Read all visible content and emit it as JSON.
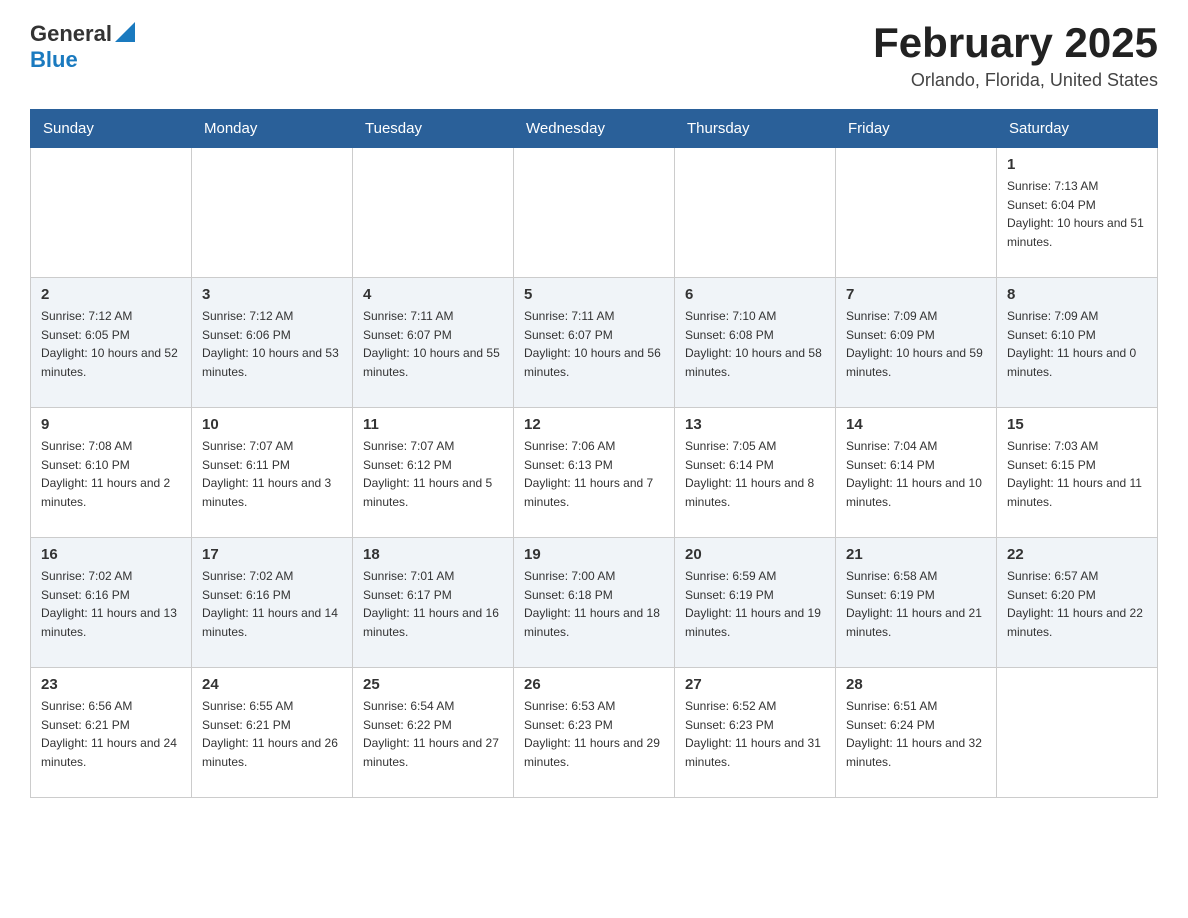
{
  "header": {
    "title": "February 2025",
    "location": "Orlando, Florida, United States",
    "logo_general": "General",
    "logo_blue": "Blue"
  },
  "days_of_week": [
    "Sunday",
    "Monday",
    "Tuesday",
    "Wednesday",
    "Thursday",
    "Friday",
    "Saturday"
  ],
  "weeks": [
    {
      "days": [
        {
          "date": "",
          "sunrise": "",
          "sunset": "",
          "daylight": ""
        },
        {
          "date": "",
          "sunrise": "",
          "sunset": "",
          "daylight": ""
        },
        {
          "date": "",
          "sunrise": "",
          "sunset": "",
          "daylight": ""
        },
        {
          "date": "",
          "sunrise": "",
          "sunset": "",
          "daylight": ""
        },
        {
          "date": "",
          "sunrise": "",
          "sunset": "",
          "daylight": ""
        },
        {
          "date": "",
          "sunrise": "",
          "sunset": "",
          "daylight": ""
        },
        {
          "date": "1",
          "sunrise": "Sunrise: 7:13 AM",
          "sunset": "Sunset: 6:04 PM",
          "daylight": "Daylight: 10 hours and 51 minutes."
        }
      ]
    },
    {
      "days": [
        {
          "date": "2",
          "sunrise": "Sunrise: 7:12 AM",
          "sunset": "Sunset: 6:05 PM",
          "daylight": "Daylight: 10 hours and 52 minutes."
        },
        {
          "date": "3",
          "sunrise": "Sunrise: 7:12 AM",
          "sunset": "Sunset: 6:06 PM",
          "daylight": "Daylight: 10 hours and 53 minutes."
        },
        {
          "date": "4",
          "sunrise": "Sunrise: 7:11 AM",
          "sunset": "Sunset: 6:07 PM",
          "daylight": "Daylight: 10 hours and 55 minutes."
        },
        {
          "date": "5",
          "sunrise": "Sunrise: 7:11 AM",
          "sunset": "Sunset: 6:07 PM",
          "daylight": "Daylight: 10 hours and 56 minutes."
        },
        {
          "date": "6",
          "sunrise": "Sunrise: 7:10 AM",
          "sunset": "Sunset: 6:08 PM",
          "daylight": "Daylight: 10 hours and 58 minutes."
        },
        {
          "date": "7",
          "sunrise": "Sunrise: 7:09 AM",
          "sunset": "Sunset: 6:09 PM",
          "daylight": "Daylight: 10 hours and 59 minutes."
        },
        {
          "date": "8",
          "sunrise": "Sunrise: 7:09 AM",
          "sunset": "Sunset: 6:10 PM",
          "daylight": "Daylight: 11 hours and 0 minutes."
        }
      ]
    },
    {
      "days": [
        {
          "date": "9",
          "sunrise": "Sunrise: 7:08 AM",
          "sunset": "Sunset: 6:10 PM",
          "daylight": "Daylight: 11 hours and 2 minutes."
        },
        {
          "date": "10",
          "sunrise": "Sunrise: 7:07 AM",
          "sunset": "Sunset: 6:11 PM",
          "daylight": "Daylight: 11 hours and 3 minutes."
        },
        {
          "date": "11",
          "sunrise": "Sunrise: 7:07 AM",
          "sunset": "Sunset: 6:12 PM",
          "daylight": "Daylight: 11 hours and 5 minutes."
        },
        {
          "date": "12",
          "sunrise": "Sunrise: 7:06 AM",
          "sunset": "Sunset: 6:13 PM",
          "daylight": "Daylight: 11 hours and 7 minutes."
        },
        {
          "date": "13",
          "sunrise": "Sunrise: 7:05 AM",
          "sunset": "Sunset: 6:14 PM",
          "daylight": "Daylight: 11 hours and 8 minutes."
        },
        {
          "date": "14",
          "sunrise": "Sunrise: 7:04 AM",
          "sunset": "Sunset: 6:14 PM",
          "daylight": "Daylight: 11 hours and 10 minutes."
        },
        {
          "date": "15",
          "sunrise": "Sunrise: 7:03 AM",
          "sunset": "Sunset: 6:15 PM",
          "daylight": "Daylight: 11 hours and 11 minutes."
        }
      ]
    },
    {
      "days": [
        {
          "date": "16",
          "sunrise": "Sunrise: 7:02 AM",
          "sunset": "Sunset: 6:16 PM",
          "daylight": "Daylight: 11 hours and 13 minutes."
        },
        {
          "date": "17",
          "sunrise": "Sunrise: 7:02 AM",
          "sunset": "Sunset: 6:16 PM",
          "daylight": "Daylight: 11 hours and 14 minutes."
        },
        {
          "date": "18",
          "sunrise": "Sunrise: 7:01 AM",
          "sunset": "Sunset: 6:17 PM",
          "daylight": "Daylight: 11 hours and 16 minutes."
        },
        {
          "date": "19",
          "sunrise": "Sunrise: 7:00 AM",
          "sunset": "Sunset: 6:18 PM",
          "daylight": "Daylight: 11 hours and 18 minutes."
        },
        {
          "date": "20",
          "sunrise": "Sunrise: 6:59 AM",
          "sunset": "Sunset: 6:19 PM",
          "daylight": "Daylight: 11 hours and 19 minutes."
        },
        {
          "date": "21",
          "sunrise": "Sunrise: 6:58 AM",
          "sunset": "Sunset: 6:19 PM",
          "daylight": "Daylight: 11 hours and 21 minutes."
        },
        {
          "date": "22",
          "sunrise": "Sunrise: 6:57 AM",
          "sunset": "Sunset: 6:20 PM",
          "daylight": "Daylight: 11 hours and 22 minutes."
        }
      ]
    },
    {
      "days": [
        {
          "date": "23",
          "sunrise": "Sunrise: 6:56 AM",
          "sunset": "Sunset: 6:21 PM",
          "daylight": "Daylight: 11 hours and 24 minutes."
        },
        {
          "date": "24",
          "sunrise": "Sunrise: 6:55 AM",
          "sunset": "Sunset: 6:21 PM",
          "daylight": "Daylight: 11 hours and 26 minutes."
        },
        {
          "date": "25",
          "sunrise": "Sunrise: 6:54 AM",
          "sunset": "Sunset: 6:22 PM",
          "daylight": "Daylight: 11 hours and 27 minutes."
        },
        {
          "date": "26",
          "sunrise": "Sunrise: 6:53 AM",
          "sunset": "Sunset: 6:23 PM",
          "daylight": "Daylight: 11 hours and 29 minutes."
        },
        {
          "date": "27",
          "sunrise": "Sunrise: 6:52 AM",
          "sunset": "Sunset: 6:23 PM",
          "daylight": "Daylight: 11 hours and 31 minutes."
        },
        {
          "date": "28",
          "sunrise": "Sunrise: 6:51 AM",
          "sunset": "Sunset: 6:24 PM",
          "daylight": "Daylight: 11 hours and 32 minutes."
        },
        {
          "date": "",
          "sunrise": "",
          "sunset": "",
          "daylight": ""
        }
      ]
    }
  ]
}
